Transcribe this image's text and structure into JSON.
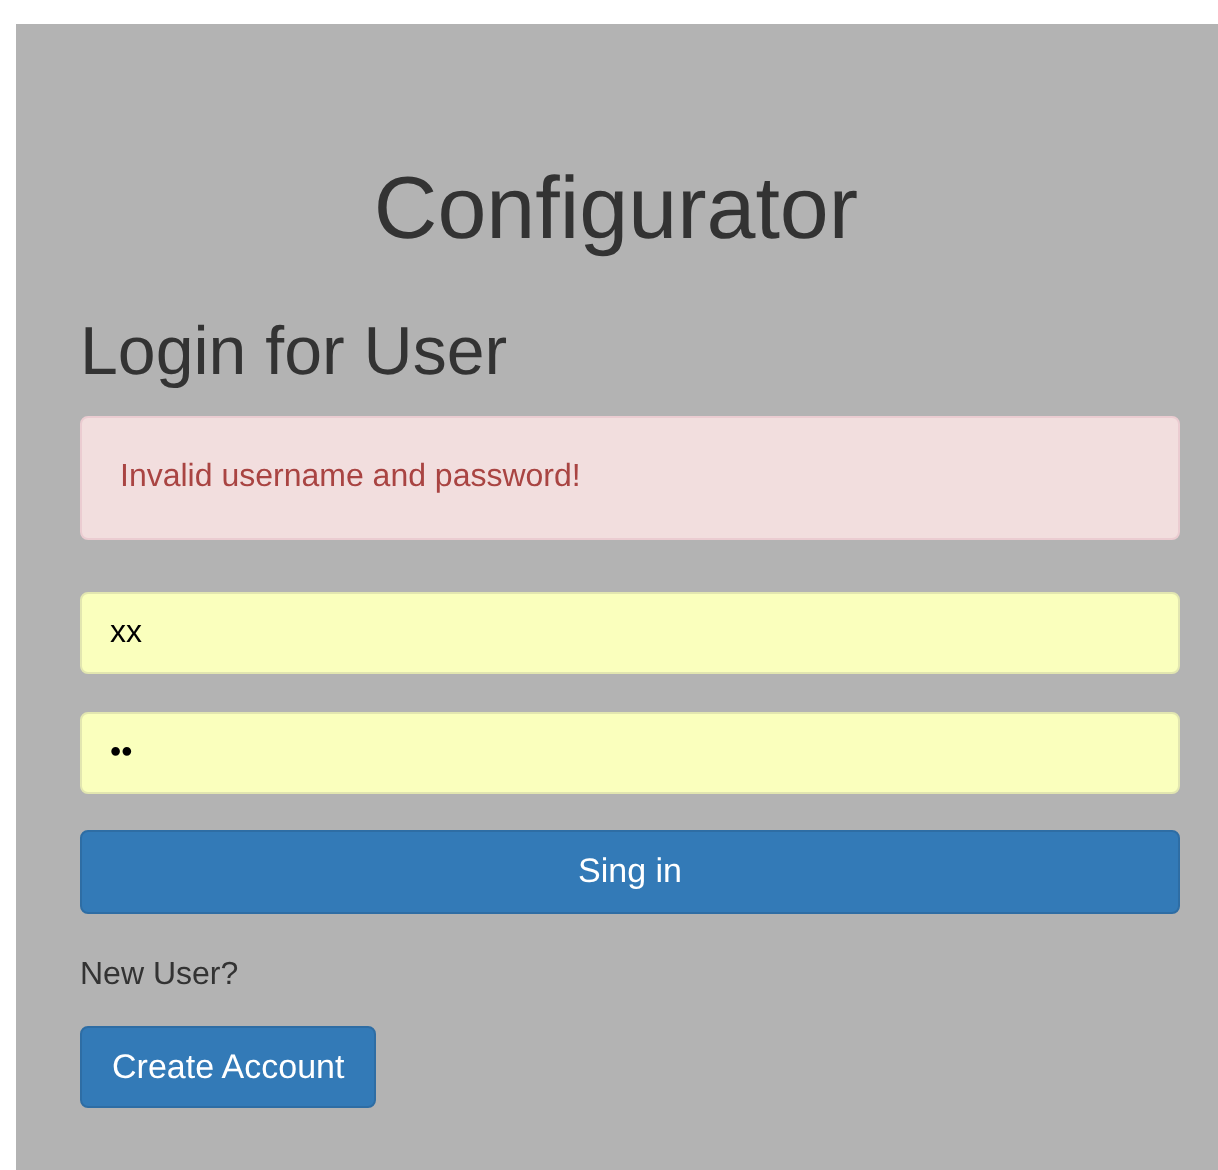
{
  "title": "Configurator",
  "heading": "Login for User",
  "alert": {
    "message": "Invalid username and password!"
  },
  "username_field": {
    "value": "xx"
  },
  "password_field": {
    "value": "••"
  },
  "sign_in_button": "Sing in",
  "new_user_label": "New User?",
  "create_account_button": "Create Account"
}
